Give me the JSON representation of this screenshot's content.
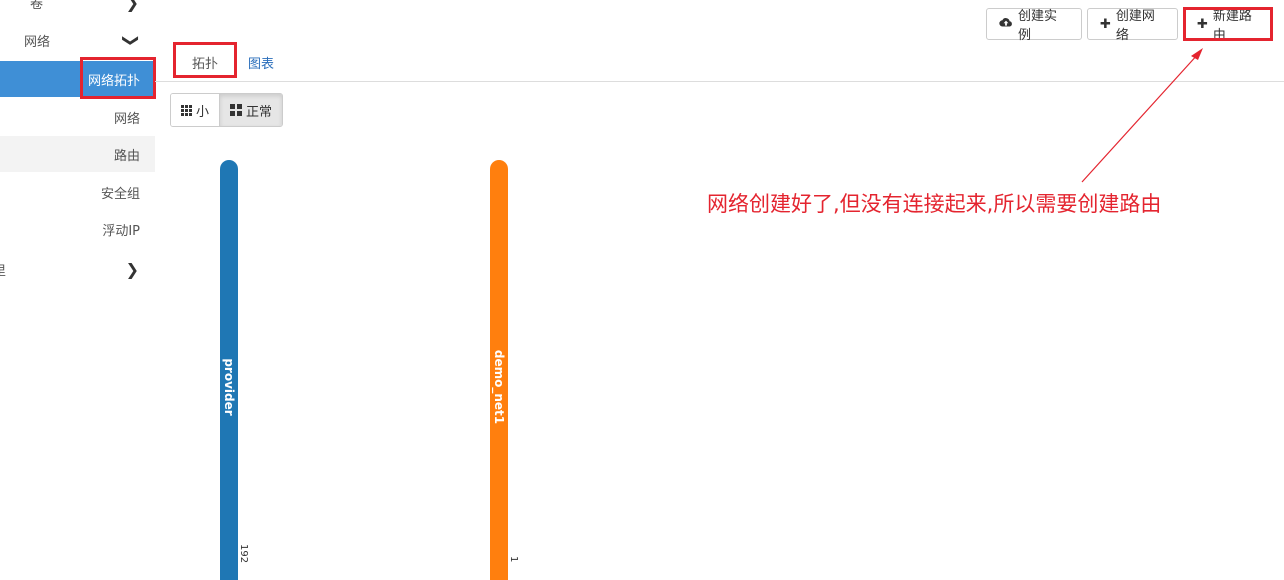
{
  "sidebar": {
    "items": [
      {
        "label": "卷",
        "expandable": true
      },
      {
        "label": "网络",
        "expandable": true,
        "expanded": true
      },
      {
        "label": "网络拓扑",
        "active": true
      },
      {
        "label": "网络"
      },
      {
        "label": "路由"
      },
      {
        "label": "安全组"
      },
      {
        "label": "浮动IP"
      },
      {
        "label": "里",
        "expandable": true
      }
    ]
  },
  "toolbar": {
    "create_instance": "创建实例",
    "create_network": "创建网络",
    "create_router": "新建路由"
  },
  "tabs": [
    {
      "label": "拓扑",
      "active": true
    },
    {
      "label": "图表",
      "active": false
    }
  ],
  "size_toggle": {
    "small": "小",
    "normal": "正常",
    "selected": "正常"
  },
  "networks": [
    {
      "name": "provider",
      "color": "#1f77b4",
      "cidr": "192"
    },
    {
      "name": "demo_net1",
      "color": "#ff7f0e",
      "cidr": "1"
    }
  ],
  "annotation": {
    "text": "网络创建好了,但没有连接起来,所以需要创建路由",
    "color": "#e4242f"
  },
  "icons": {
    "create_instance": "cloud-upload-icon",
    "create_network": "plus-icon",
    "create_router": "plus-icon",
    "small": "th-icon",
    "normal": "th-large-icon",
    "expand": "chevron-icon"
  }
}
